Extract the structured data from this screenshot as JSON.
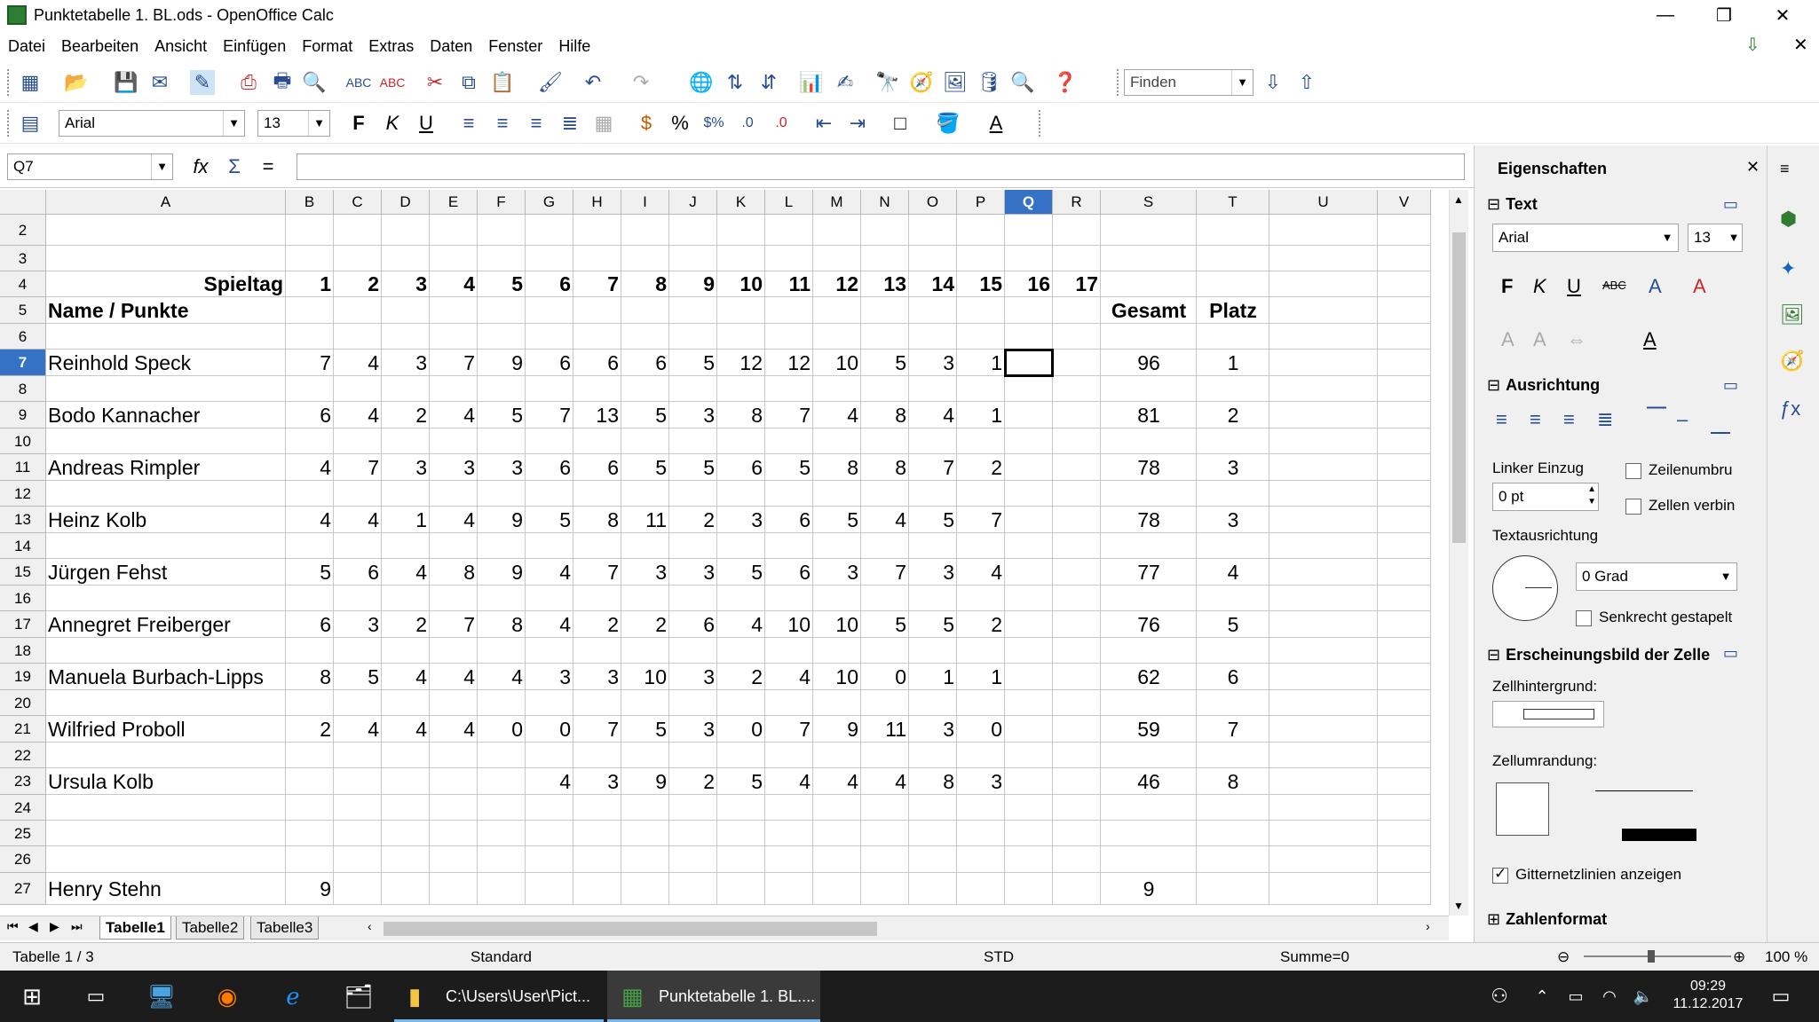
{
  "window": {
    "title": "Punktetabelle 1. BL.ods - OpenOffice Calc"
  },
  "menu": [
    "Datei",
    "Bearbeiten",
    "Ansicht",
    "Einfügen",
    "Format",
    "Extras",
    "Daten",
    "Fenster",
    "Hilfe"
  ],
  "toolbar": {
    "find_placeholder": "Finden"
  },
  "formatting": {
    "font": "Arial",
    "size": "13"
  },
  "formula_bar": {
    "cell_ref": "Q7",
    "content": ""
  },
  "sheet": {
    "columns": [
      "A",
      "B",
      "C",
      "D",
      "E",
      "F",
      "G",
      "H",
      "I",
      "J",
      "K",
      "L",
      "M",
      "N",
      "O",
      "P",
      "Q",
      "R",
      "S",
      "T",
      "U",
      "V"
    ],
    "selected_column": "Q",
    "selected_row": "7",
    "row_numbers": [
      "2",
      "3",
      "4",
      "5",
      "6",
      "7",
      "8",
      "9",
      "10",
      "11",
      "12",
      "13",
      "14",
      "15",
      "16",
      "17",
      "18",
      "19",
      "20",
      "21",
      "22",
      "23",
      "24",
      "25",
      "26",
      "27"
    ],
    "header_row": {
      "label": "Spieltag",
      "days": [
        "1",
        "2",
        "3",
        "4",
        "5",
        "6",
        "7",
        "8",
        "9",
        "10",
        "11",
        "12",
        "13",
        "14",
        "15",
        "16",
        "17"
      ]
    },
    "subheader": {
      "label": "Name / Punkte",
      "total": "Gesamt",
      "rank": "Platz"
    },
    "players": [
      {
        "row": "7",
        "name": "Reinhold Speck",
        "points": [
          "7",
          "4",
          "3",
          "7",
          "9",
          "6",
          "6",
          "6",
          "5",
          "12",
          "12",
          "10",
          "5",
          "3",
          "1",
          "",
          ""
        ],
        "total": "96",
        "rank": "1"
      },
      {
        "row": "9",
        "name": "Bodo Kannacher",
        "points": [
          "6",
          "4",
          "2",
          "4",
          "5",
          "7",
          "13",
          "5",
          "3",
          "8",
          "7",
          "4",
          "8",
          "4",
          "1",
          "",
          ""
        ],
        "total": "81",
        "rank": "2"
      },
      {
        "row": "11",
        "name": "Andreas Rimpler",
        "points": [
          "4",
          "7",
          "3",
          "3",
          "3",
          "6",
          "6",
          "5",
          "5",
          "6",
          "5",
          "8",
          "8",
          "7",
          "2",
          "",
          ""
        ],
        "total": "78",
        "rank": "3"
      },
      {
        "row": "13",
        "name": "Heinz Kolb",
        "points": [
          "4",
          "4",
          "1",
          "4",
          "9",
          "5",
          "8",
          "11",
          "2",
          "3",
          "6",
          "5",
          "4",
          "5",
          "7",
          "",
          ""
        ],
        "total": "78",
        "rank": "3"
      },
      {
        "row": "15",
        "name": "Jürgen Fehst",
        "points": [
          "5",
          "6",
          "4",
          "8",
          "9",
          "4",
          "7",
          "3",
          "3",
          "5",
          "6",
          "3",
          "7",
          "3",
          "4",
          "",
          ""
        ],
        "total": "77",
        "rank": "4"
      },
      {
        "row": "17",
        "name": "Annegret Freiberger",
        "points": [
          "6",
          "3",
          "2",
          "7",
          "8",
          "4",
          "2",
          "2",
          "6",
          "4",
          "10",
          "10",
          "5",
          "5",
          "2",
          "",
          ""
        ],
        "total": "76",
        "rank": "5"
      },
      {
        "row": "19",
        "name": "Manuela Burbach-Lipps",
        "points": [
          "8",
          "5",
          "4",
          "4",
          "4",
          "3",
          "3",
          "10",
          "3",
          "2",
          "4",
          "10",
          "0",
          "1",
          "1",
          "",
          ""
        ],
        "total": "62",
        "rank": "6"
      },
      {
        "row": "21",
        "name": "Wilfried Proboll",
        "points": [
          "2",
          "4",
          "4",
          "4",
          "0",
          "0",
          "7",
          "5",
          "3",
          "0",
          "7",
          "9",
          "11",
          "3",
          "0",
          "",
          ""
        ],
        "total": "59",
        "rank": "7"
      },
      {
        "row": "23",
        "name": "Ursula Kolb",
        "points": [
          "",
          "",
          "",
          "",
          "",
          "4",
          "3",
          "9",
          "2",
          "5",
          "4",
          "4",
          "4",
          "8",
          "3",
          "",
          ""
        ],
        "total": "46",
        "rank": "8"
      },
      {
        "row": "27",
        "name": "Henry Stehn",
        "points": [
          "9",
          "",
          "",
          "",
          "",
          "",
          "",
          "",
          "",
          "",
          "",
          "",
          "",
          "",
          "",
          "",
          ""
        ],
        "total": "9",
        "rank": ""
      }
    ],
    "tabs": [
      "Tabelle1",
      "Tabelle2",
      "Tabelle3"
    ],
    "active_tab": "Tabelle1"
  },
  "status": {
    "sheet": "Tabelle 1 / 3",
    "style": "Standard",
    "mode": "STD",
    "sum": "Summe=0",
    "zoom": "100 %"
  },
  "sidebar": {
    "title": "Eigenschaften",
    "text_section": "Text",
    "font": "Arial",
    "size": "13",
    "align_section": "Ausrichtung",
    "indent_label": "Linker Einzug",
    "indent_value": "0 pt",
    "wrap_label": "Zeilenumbru",
    "merge_label": "Zellen verbin",
    "orientation_label": "Textausrichtung",
    "orientation_value": "0 Grad",
    "vertical_label": "Senkrecht gestapelt",
    "appearance_section": "Erscheinungsbild der Zelle",
    "bg_label": "Zellhintergrund:",
    "border_label": "Zellumrandung:",
    "grid_label": "Gitternetzlinien anzeigen",
    "number_section": "Zahlenformat"
  },
  "taskbar": {
    "explorer_label": "C:\\Users\\User\\Pict...",
    "calc_label": "Punktetabelle 1. BL....",
    "time": "09:29",
    "date": "11.12.2017"
  }
}
